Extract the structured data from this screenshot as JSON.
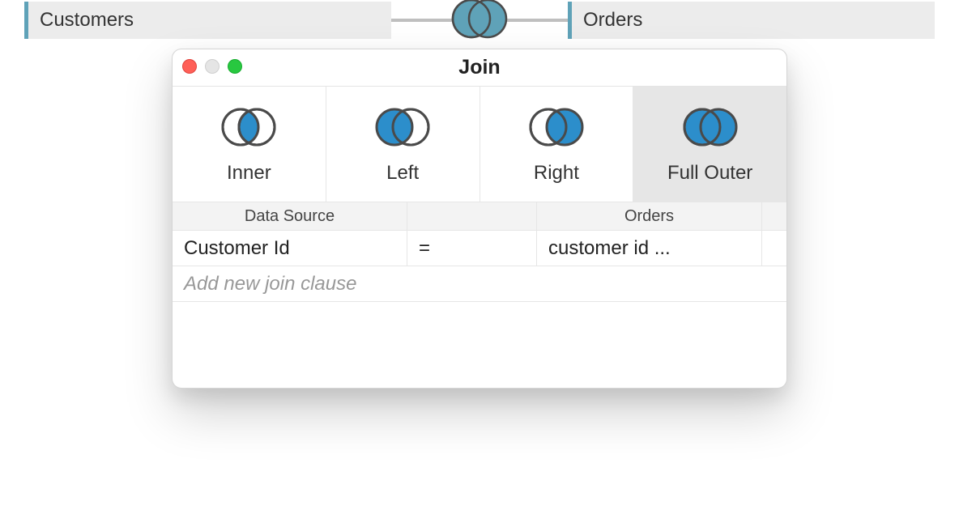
{
  "colors": {
    "accent": "#5fa2b8",
    "joinFill": "#2c8ecb",
    "stroke": "#4a4a4a"
  },
  "tables": {
    "left": "Customers",
    "right": "Orders"
  },
  "link_icon": "full-outer-icon",
  "dialog": {
    "title": "Join",
    "types": [
      {
        "key": "inner",
        "label": "Inner",
        "icon": "inner-icon"
      },
      {
        "key": "left",
        "label": "Left",
        "icon": "left-icon"
      },
      {
        "key": "right",
        "label": "Right",
        "icon": "right-icon"
      },
      {
        "key": "full",
        "label": "Full Outer",
        "icon": "full-icon"
      }
    ],
    "selected": "full",
    "header": {
      "left": "Data Source",
      "right": "Orders"
    },
    "clause": {
      "left_field": "Customer Id",
      "operator": "=",
      "right_field": "customer id ..."
    },
    "add_placeholder": "Add new join clause"
  }
}
